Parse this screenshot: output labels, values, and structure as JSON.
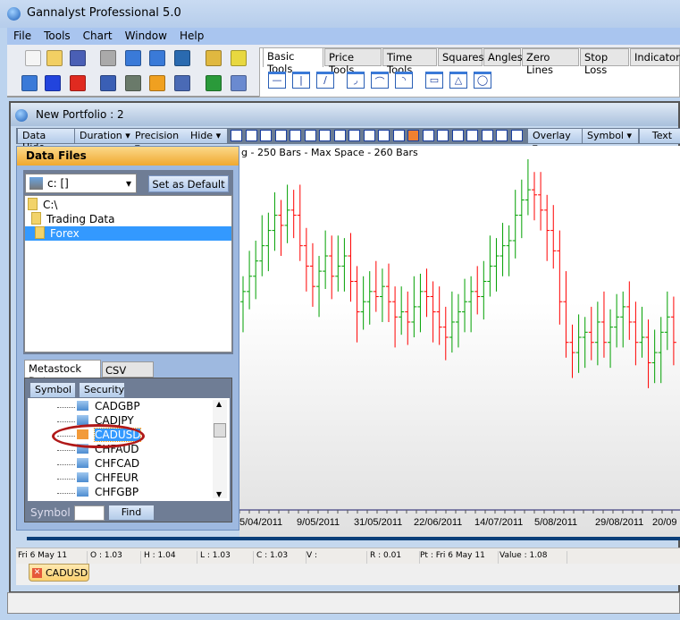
{
  "app": {
    "title": "Gannalyst Professional 5.0"
  },
  "menu": [
    "File",
    "Tools",
    "Chart",
    "Window",
    "Help"
  ],
  "toolbar_icons": [
    "new-icon",
    "open-icon",
    "save-icon",
    "print-icon",
    "split-horizontal-icon",
    "split-vertical-icon",
    "export-icon",
    "lock-icon",
    "pointer-icon",
    "calculator-icon",
    "select-icon",
    "delete-icon",
    "film-icon",
    "import-icon",
    "grid-icon",
    "drawing-tools-icon",
    "globe-icon",
    "settings-icon"
  ],
  "tool_tabs": [
    "Basic Tools",
    "Price Tools",
    "Time Tools",
    "Squares",
    "Angles",
    "Zero Lines",
    "Stop Loss",
    "Indicators"
  ],
  "tool_buttons": [
    "horizontal-line",
    "vertical-line",
    "trend-line",
    "arc-left",
    "arc",
    "arc-right",
    "rectangle",
    "triangle",
    "ellipse"
  ],
  "child": {
    "title": "New Portfolio : 2",
    "buttons": {
      "data_hide": "Data Hide",
      "duration": "Duration",
      "precision": "Precision",
      "hide": "Hide",
      "overlay": "Overlay",
      "symbol": "Symbol",
      "text": "Text"
    }
  },
  "panel": {
    "title": "Data Files",
    "drive": "c: []",
    "set_default": "Set as Default",
    "tree": [
      "C:\\",
      "Trading Data",
      "Forex"
    ],
    "selected_folder": "Forex",
    "tabs": [
      "Metastock Data",
      "CSV Data"
    ],
    "active_tab": "Metastock Data",
    "columns": [
      "Symbol",
      "Security"
    ],
    "symbols": [
      "CADGBP",
      "CADJPY",
      "CADUSD",
      "CHFAUD",
      "CHFCAD",
      "CHFEUR",
      "CHFGBP"
    ],
    "selected_symbol": "CADUSD",
    "find_label": "Symbol",
    "find_value": "",
    "find_button": "Find"
  },
  "chart": {
    "info": "g - 250 Bars -  Max Space - 260 Bars"
  },
  "chart_data": {
    "type": "ohlc",
    "x_tick_labels": [
      "5/04/2011",
      "9/05/2011",
      "31/05/2011",
      "22/06/2011",
      "14/07/2011",
      "5/08/2011",
      "29/08/2011",
      "20/09"
    ],
    "closes": [
      1.04,
      1.043,
      1.046,
      1.049,
      1.052,
      1.055,
      1.053,
      1.056,
      1.055,
      1.049,
      1.045,
      1.041,
      1.044,
      1.047,
      1.043,
      1.045,
      1.047,
      1.042,
      1.036,
      1.038,
      1.04,
      1.039,
      1.041,
      1.038,
      1.035,
      1.036,
      1.034,
      1.037,
      1.04,
      1.039,
      1.036,
      1.033,
      1.031,
      1.034,
      1.036,
      1.038,
      1.04,
      1.039,
      1.042,
      1.045,
      1.047,
      1.049,
      1.05,
      1.055,
      1.058,
      1.06,
      1.059,
      1.056,
      1.052,
      1.048,
      1.038,
      1.03,
      1.028,
      1.031,
      1.032,
      1.03,
      1.034,
      1.03,
      1.033,
      1.035,
      1.037,
      1.034,
      1.03,
      1.031,
      1.026,
      1.028,
      1.032,
      1.035,
      1.03
    ],
    "up_color": "#00a000",
    "down_color": "#ff0000",
    "neutral_color": "#555555"
  },
  "status": {
    "date": "Fri 6 May 11",
    "open": "O : 1.03",
    "high": "H : 1.04",
    "low": "L : 1.03",
    "close": "C : 1.03",
    "volume": "V :",
    "range": "R : 0.01",
    "pt": "Pt : Fri 6 May 11",
    "value": "Value : 1.08"
  },
  "doc_tab": "CADUSD"
}
